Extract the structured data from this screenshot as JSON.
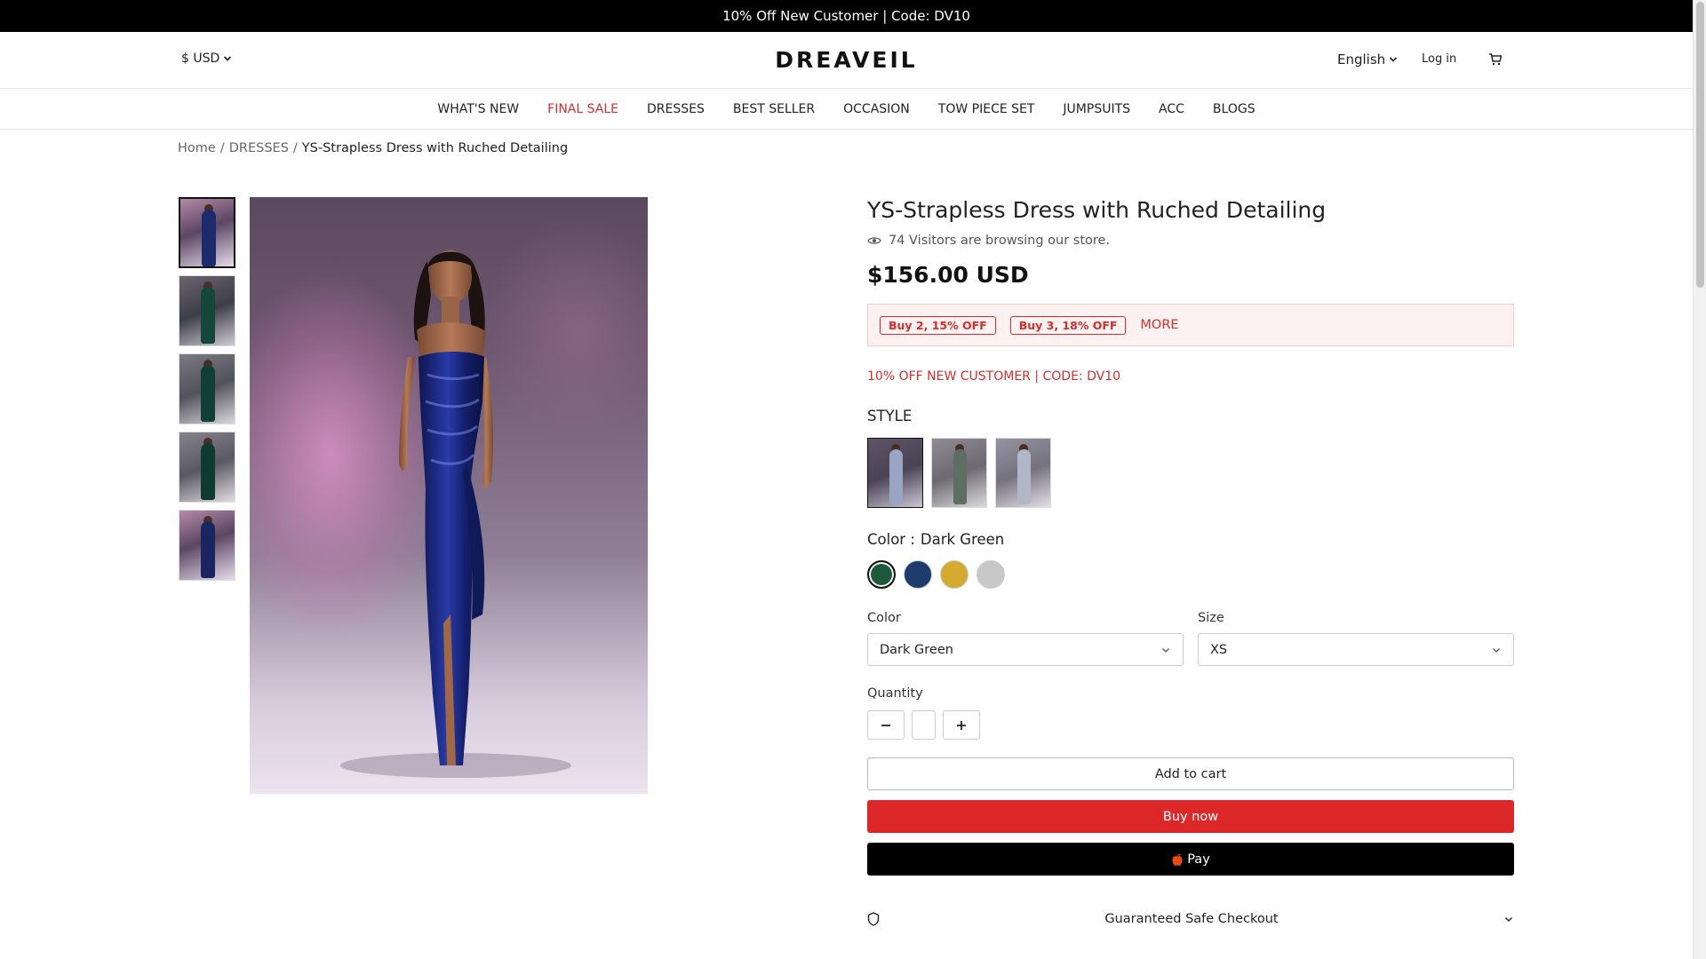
{
  "announcement": "10% Off New Customer | Code: DV10",
  "header": {
    "currency": "$ USD",
    "logo": "DREAVEIL",
    "language": "English",
    "login": "Log in",
    "cart_icon": "cart-icon"
  },
  "nav": {
    "items": [
      {
        "label": "WHAT'S NEW"
      },
      {
        "label": "FINAL SALE"
      },
      {
        "label": "DRESSES"
      },
      {
        "label": "BEST SELLER"
      },
      {
        "label": "OCCASION"
      },
      {
        "label": "TOW PIECE SET"
      },
      {
        "label": "JUMPSUITS"
      },
      {
        "label": "ACC"
      },
      {
        "label": "BLOGS"
      }
    ]
  },
  "breadcrumb": {
    "home": "Home",
    "sep1": "/",
    "category": "DRESSES",
    "sep2": "/",
    "current": "YS-Strapless Dress with Ruched Detailing"
  },
  "product": {
    "title": "YS-Strapless Dress with Ruched Detailing",
    "visitors": "74 Visitors are browsing our store.",
    "price": "$156.00 USD",
    "promos": [
      "Buy 2, 15% OFF",
      "Buy 3, 18% OFF"
    ],
    "promo_more": "MORE",
    "new_customer": "10% OFF NEW CUSTOMER | CODE: DV10",
    "style_label": "STYLE",
    "color_label": "Color :",
    "color_value": "Dark Green",
    "swatch_colors": [
      "#1e5a3a",
      "#1f3b6b",
      "#d4aa30",
      "#c8c8c8"
    ],
    "color_select_label": "Color",
    "color_select_value": "Dark Green",
    "size_select_label": "Size",
    "size_select_value": "XS",
    "quantity_label": "Quantity",
    "quantity_value": "",
    "add_to_cart": "Add to cart",
    "buy_now": "Buy now",
    "apple_pay": "Pay",
    "safe_checkout": "Guaranteed Safe Checkout"
  },
  "colors": {
    "accent_red": "#dc2828",
    "promo_bg": "#fdf1f1"
  }
}
